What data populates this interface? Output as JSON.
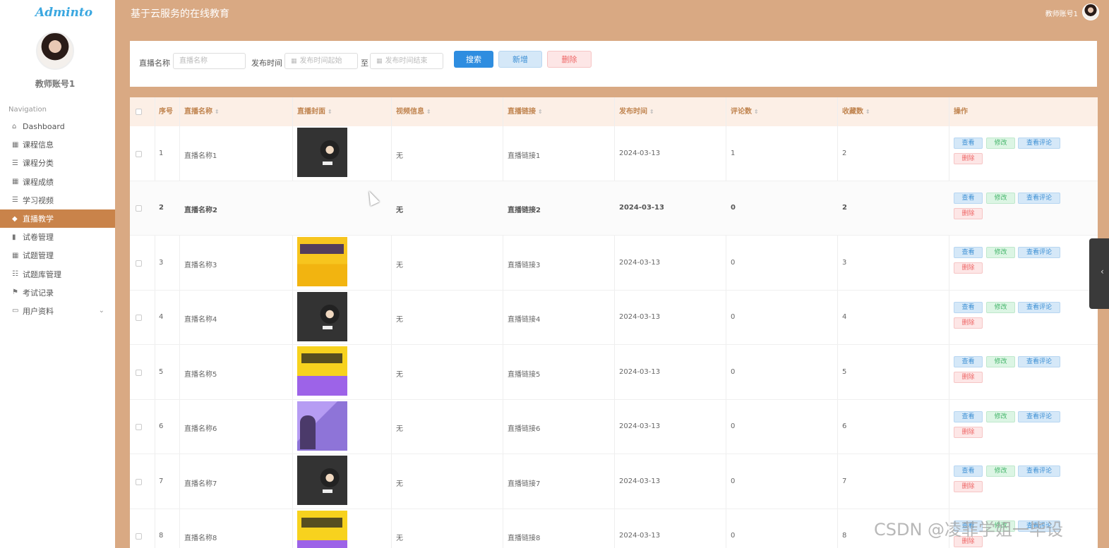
{
  "app": {
    "logo": "Adminto",
    "title": "基于云服务的在线教育",
    "user": "教师账号1"
  },
  "sidebar": {
    "user_name": "教师账号1",
    "nav_label": "Navigation",
    "items": [
      {
        "label": "Dashboard",
        "icon": "home-icon"
      },
      {
        "label": "课程信息",
        "icon": "grid-icon"
      },
      {
        "label": "课程分类",
        "icon": "list-icon"
      },
      {
        "label": "课程成绩",
        "icon": "grid-icon"
      },
      {
        "label": "学习视频",
        "icon": "list-icon"
      },
      {
        "label": "直播教学",
        "icon": "thumb-icon",
        "active": true
      },
      {
        "label": "试卷管理",
        "icon": "doc-icon"
      },
      {
        "label": "试题管理",
        "icon": "grid-icon"
      },
      {
        "label": "试题库管理",
        "icon": "sliders-icon"
      },
      {
        "label": "考试记录",
        "icon": "flag-icon"
      },
      {
        "label": "用户资料",
        "icon": "card-icon",
        "has_submenu": true
      }
    ]
  },
  "search": {
    "name_label": "直播名称",
    "name_placeholder": "直播名称",
    "date_label": "发布时间",
    "start_placeholder": "发布时间起始",
    "to_label": "至",
    "end_placeholder": "发布时间结束",
    "search_btn": "搜索",
    "add_btn": "新增",
    "delete_btn": "删除"
  },
  "table": {
    "columns": [
      "序号",
      "直播名称",
      "直播封面",
      "视频信息",
      "直播链接",
      "发布时间",
      "评论数",
      "收藏数",
      "操作"
    ],
    "rows": [
      {
        "idx": "1",
        "name": "直播名称1",
        "cover": "dark",
        "video": "无",
        "link": "直播链接1",
        "date": "2024-03-13",
        "comments": "1",
        "favorites": "2"
      },
      {
        "idx": "2",
        "name": "直播名称2",
        "cover": "",
        "video": "无",
        "link": "直播链接2",
        "date": "2024-03-13",
        "comments": "0",
        "favorites": "2"
      },
      {
        "idx": "3",
        "name": "直播名称3",
        "cover": "yellow",
        "video": "无",
        "link": "直播链接3",
        "date": "2024-03-13",
        "comments": "0",
        "favorites": "3"
      },
      {
        "idx": "4",
        "name": "直播名称4",
        "cover": "dark",
        "video": "无",
        "link": "直播链接4",
        "date": "2024-03-13",
        "comments": "0",
        "favorites": "4"
      },
      {
        "idx": "5",
        "name": "直播名称5",
        "cover": "yp",
        "video": "无",
        "link": "直播链接5",
        "date": "2024-03-13",
        "comments": "0",
        "favorites": "5"
      },
      {
        "idx": "6",
        "name": "直播名称6",
        "cover": "purple",
        "video": "无",
        "link": "直播链接6",
        "date": "2024-03-13",
        "comments": "0",
        "favorites": "6"
      },
      {
        "idx": "7",
        "name": "直播名称7",
        "cover": "dark",
        "video": "无",
        "link": "直播链接7",
        "date": "2024-03-13",
        "comments": "0",
        "favorites": "7"
      },
      {
        "idx": "8",
        "name": "直播名称8",
        "cover": "yp",
        "video": "无",
        "link": "直播链接8",
        "date": "2024-03-13",
        "comments": "0",
        "favorites": "8"
      }
    ],
    "actions": {
      "view": "查看",
      "edit": "修改",
      "comments": "查看评论",
      "delete": "删除"
    }
  },
  "watermark": "CSDN @凌菲学姐一毕设",
  "colors": {
    "header_bg": "#d9a983",
    "active_menu": "#c9834a",
    "primary": "#2e8de0"
  }
}
